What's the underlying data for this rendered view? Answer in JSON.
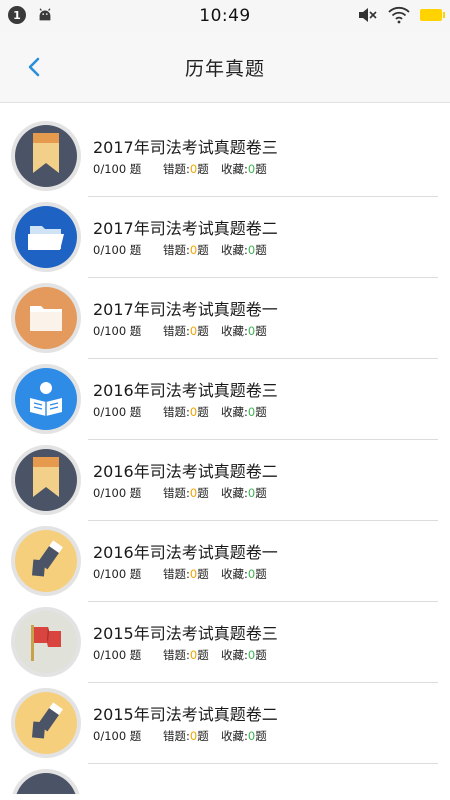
{
  "status_bar": {
    "notification_count": "1",
    "time": "10:49",
    "icons": [
      "android-icon",
      "mute-icon",
      "wifi-icon",
      "battery-icon"
    ]
  },
  "header": {
    "title": "历年真题",
    "back_icon": "chevron-left-icon"
  },
  "list": {
    "items": [
      {
        "title": "2017年司法考试真题卷三",
        "progress": "0/100 题",
        "wrong_label": "错题:",
        "wrong_count": "0",
        "wrong_suffix": "题",
        "fav_label": "收藏:",
        "fav_count": "0",
        "fav_suffix": "题",
        "icon": "bookmark-icon"
      },
      {
        "title": "2017年司法考试真题卷二",
        "progress": "0/100 题",
        "wrong_label": "错题:",
        "wrong_count": "0",
        "wrong_suffix": "题",
        "fav_label": "收藏:",
        "fav_count": "0",
        "fav_suffix": "题",
        "icon": "open-folder-icon"
      },
      {
        "title": "2017年司法考试真题卷一",
        "progress": "0/100 题",
        "wrong_label": "错题:",
        "wrong_count": "0",
        "wrong_suffix": "题",
        "fav_label": "收藏:",
        "fav_count": "0",
        "fav_suffix": "题",
        "icon": "folder-icon"
      },
      {
        "title": "2016年司法考试真题卷三",
        "progress": "0/100 题",
        "wrong_label": "错题:",
        "wrong_count": "0",
        "wrong_suffix": "题",
        "fav_label": "收藏:",
        "fav_count": "0",
        "fav_suffix": "题",
        "icon": "reader-icon"
      },
      {
        "title": "2016年司法考试真题卷二",
        "progress": "0/100 题",
        "wrong_label": "错题:",
        "wrong_count": "0",
        "wrong_suffix": "题",
        "fav_label": "收藏:",
        "fav_count": "0",
        "fav_suffix": "题",
        "icon": "bookmark-icon"
      },
      {
        "title": "2016年司法考试真题卷一",
        "progress": "0/100 题",
        "wrong_label": "错题:",
        "wrong_count": "0",
        "wrong_suffix": "题",
        "fav_label": "收藏:",
        "fav_count": "0",
        "fav_suffix": "题",
        "icon": "pencil-icon"
      },
      {
        "title": "2015年司法考试真题卷三",
        "progress": "0/100 题",
        "wrong_label": "错题:",
        "wrong_count": "0",
        "wrong_suffix": "题",
        "fav_label": "收藏:",
        "fav_count": "0",
        "fav_suffix": "题",
        "icon": "flag-icon"
      },
      {
        "title": "2015年司法考试真题卷二",
        "progress": "0/100 题",
        "wrong_label": "错题:",
        "wrong_count": "0",
        "wrong_suffix": "题",
        "fav_label": "收藏:",
        "fav_count": "0",
        "fav_suffix": "题",
        "icon": "pencil-icon"
      }
    ]
  },
  "colors": {
    "accent_blue": "#2a8fd8",
    "wrong_count_color": "#f0a500",
    "fav_count_color": "#3db551"
  }
}
